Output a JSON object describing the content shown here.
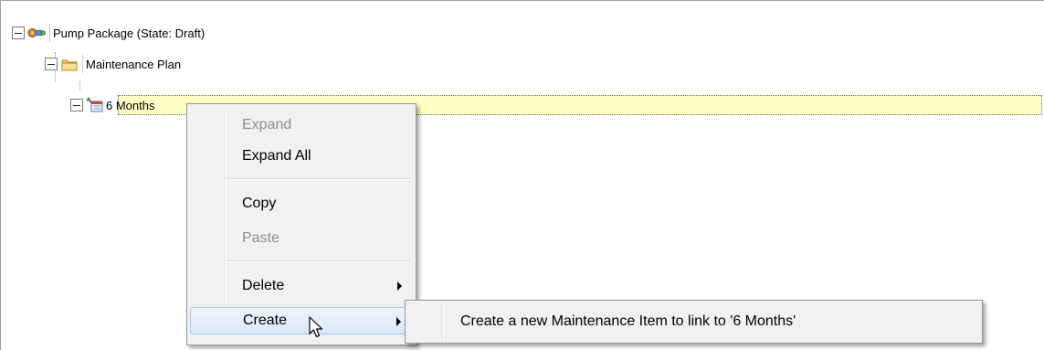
{
  "tree": {
    "root": {
      "label": "Pump Package (State: Draft)",
      "icon": "pump-package-icon"
    },
    "folder": {
      "label": "Maintenance Plan",
      "icon": "folder-icon"
    },
    "item": {
      "label": "6 Months",
      "icon": "maintenance-schedule-icon"
    }
  },
  "context_menu": {
    "items": [
      {
        "label": "Expand",
        "enabled": false
      },
      {
        "label": "Expand All",
        "enabled": true
      },
      {
        "label": "Copy",
        "enabled": true
      },
      {
        "label": "Paste",
        "enabled": false
      },
      {
        "label": "Delete",
        "enabled": true,
        "submenu": true
      },
      {
        "label": "Create",
        "enabled": true,
        "submenu": true,
        "highlighted": true
      }
    ]
  },
  "submenu": {
    "items": [
      {
        "label": "Create a new Maintenance Item to link to '6 Months'"
      }
    ]
  },
  "colors": {
    "selection_background": "#ffffc4",
    "menu_background": "#f1f1f1",
    "menu_hover": "#dbe8f9",
    "disabled_text": "#8d8d8d"
  }
}
